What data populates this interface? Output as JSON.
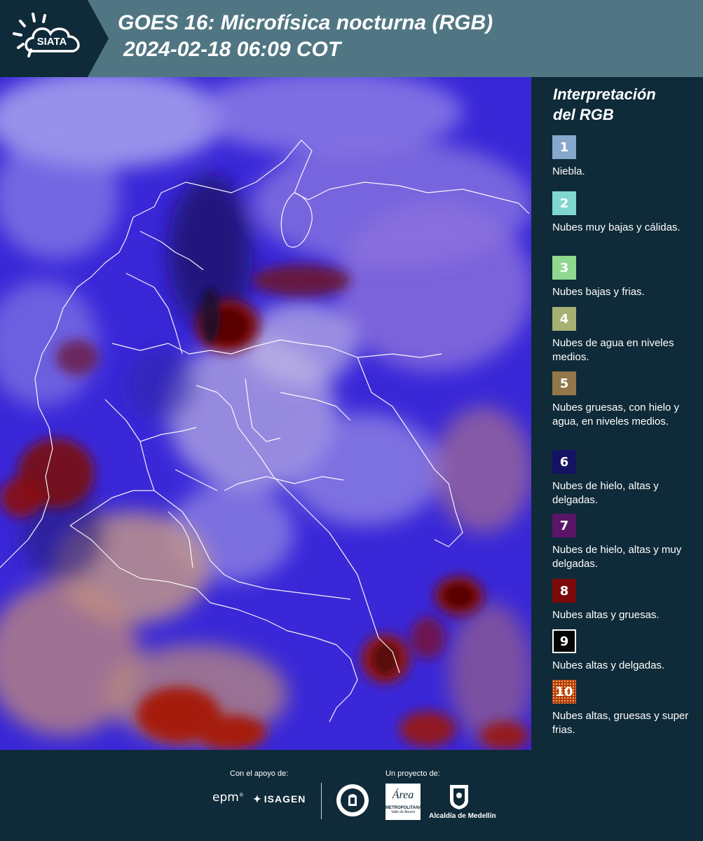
{
  "header": {
    "logo_text": "SIATA",
    "title_line1": "GOES 16: Microfísica nocturna (RGB)",
    "title_line2": "2024-02-18 06:09 COT"
  },
  "map": {
    "colors": {
      "base": "#3a28d8",
      "light": "#9c8ee8",
      "pale": "#c9c4ef",
      "dark_red": "#7a1010",
      "red": "#a51c0c",
      "tan": "#c59a86",
      "navy": "#1b1660",
      "border": "#ffffff"
    }
  },
  "legend": {
    "title_line1": "Interpretación",
    "title_line2": "del RGB",
    "items": [
      {
        "num": "1",
        "label": "Niebla.",
        "color": "#86a8cc"
      },
      {
        "num": "2",
        "label": "Nubes muy bajas y cálidas.",
        "color": "#7fd7d0"
      },
      {
        "num": "3",
        "label": "Nubes bajas y frias.",
        "color": "#8fd890"
      },
      {
        "num": "4",
        "label": "Nubes de agua en niveles medios.",
        "color": "#a5b073"
      },
      {
        "num": "5",
        "label": "Nubes gruesas, con hielo y agua, en niveles medios.",
        "color": "#947748"
      },
      {
        "num": "6",
        "label": "Nubes de hielo, altas y delgadas.",
        "color": "#141262"
      },
      {
        "num": "7",
        "label": "Nubes de hielo, altas y muy delgadas.",
        "color": "#5a1566"
      },
      {
        "num": "8",
        "label": "Nubes altas y gruesas.",
        "color": "#7c0a0a"
      },
      {
        "num": "9",
        "label": "Nubes altas y delgadas.",
        "color": "#050505"
      },
      {
        "num": "10",
        "label": "Nubes altas, gruesas y super frias.",
        "color": "#b3300f"
      }
    ]
  },
  "footer": {
    "support_label": "Con el apoyo de:",
    "project_label": "Un proyecto de:",
    "sponsor1": "epm",
    "sponsor2": "ISAGEN",
    "sponsor3_line1": "METROPOLITANA",
    "sponsor3_line2": "Valle de Aburrá",
    "sponsor3_script": "Área",
    "sponsor4": "Alcaldía de Medellín"
  }
}
